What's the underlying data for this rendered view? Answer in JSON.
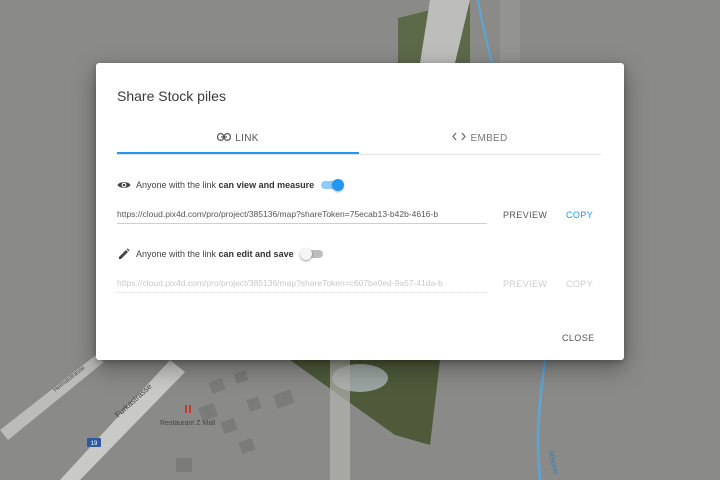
{
  "dialog": {
    "title": "Share Stock piles",
    "tabs": [
      {
        "label": "LINK",
        "icon": "link-icon",
        "active": true
      },
      {
        "label": "EMBED",
        "icon": "code-icon",
        "active": false
      }
    ],
    "view_permission": {
      "icon": "eye-icon",
      "prefix": "Anyone with the link ",
      "emphasis": "can view and measure",
      "enabled": true,
      "url": "https://cloud.pix4d.com/pro/project/385136/map?shareToken=75ecab13-b42b-4616-b",
      "preview_label": "PREVIEW",
      "copy_label": "COPY"
    },
    "edit_permission": {
      "icon": "pencil-icon",
      "prefix": "Anyone with the link ",
      "emphasis": "can edit and save",
      "enabled": false,
      "url": "https://cloud.pix4d.com/pro/project/385136/map?shareToken=c607be0ed-9a57-41da-b",
      "preview_label": "PREVIEW",
      "copy_label": "COPY"
    },
    "close_label": "CLOSE"
  },
  "map": {
    "labels": {
      "street1": "Furkastrasse",
      "street2": "Heimatstrasse",
      "place": "Restaurant Z Mall",
      "river": "Rhone",
      "road_badge": "19"
    }
  },
  "colors": {
    "accent": "#2196f3",
    "map_background": "#8a8a88",
    "road": "#c9c9c7",
    "river": "#5aa7d9"
  }
}
